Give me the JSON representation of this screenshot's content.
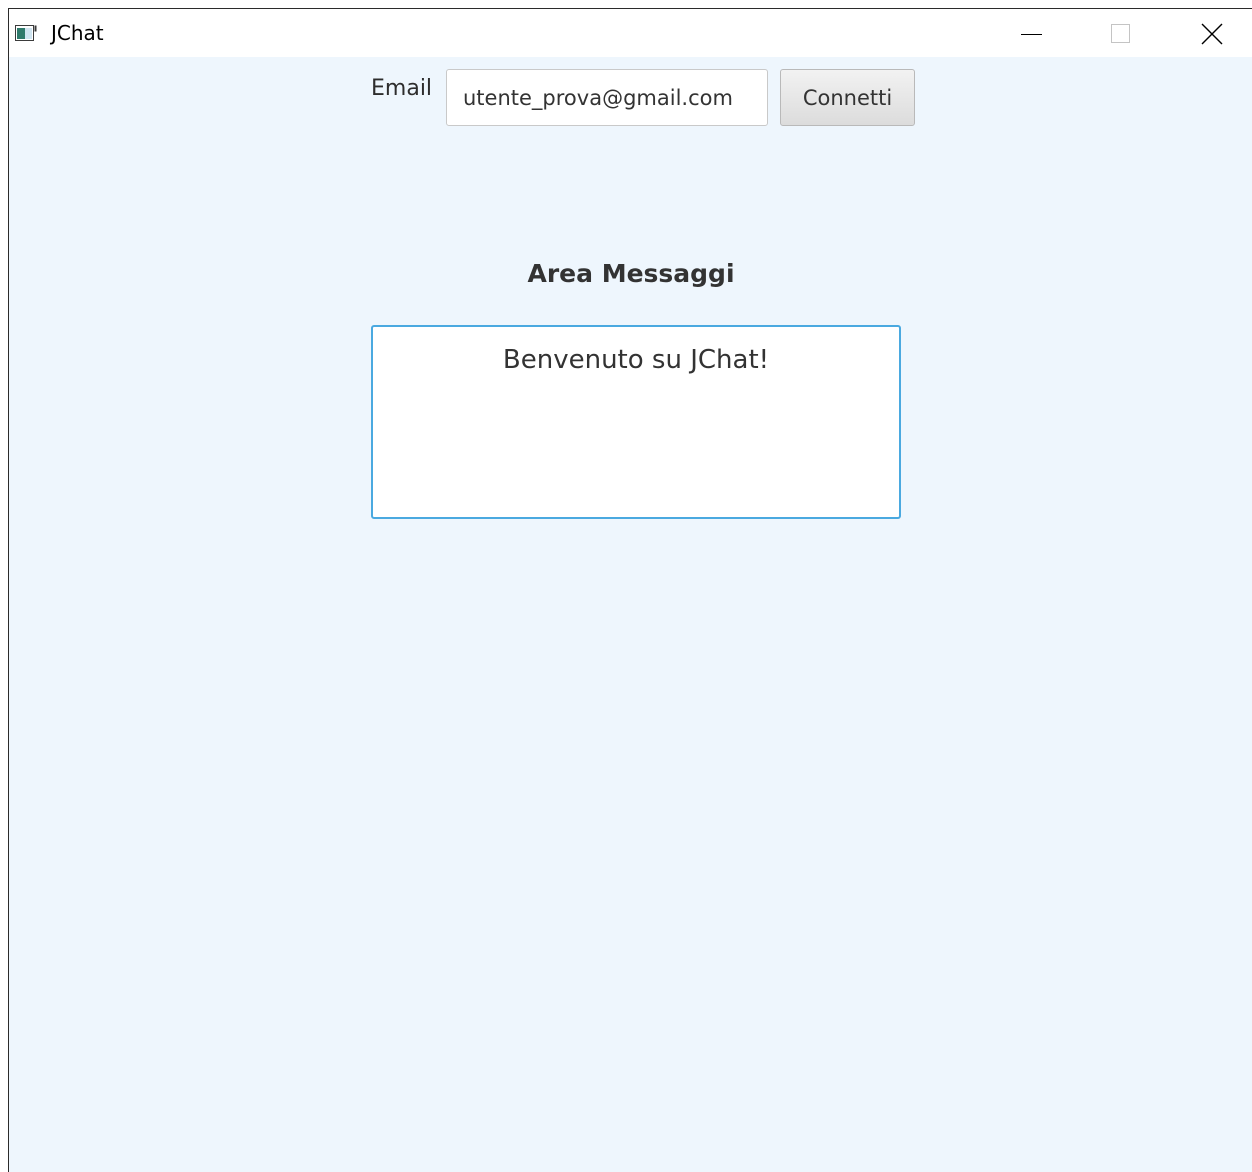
{
  "window": {
    "title": "JChat",
    "icons": {
      "app": "app-window-icon",
      "minimize": "minimize-icon",
      "maximize": "maximize-icon",
      "close": "close-icon"
    }
  },
  "login": {
    "email_label": "Email",
    "email_value": "utente_prova@gmail.com",
    "connect_label": "Connetti"
  },
  "messages": {
    "title": "Area Messaggi",
    "content": "Benvenuto su JChat!"
  },
  "colors": {
    "background": "#eef6fd",
    "focus_border": "#4aa9e0",
    "text": "#333333"
  }
}
